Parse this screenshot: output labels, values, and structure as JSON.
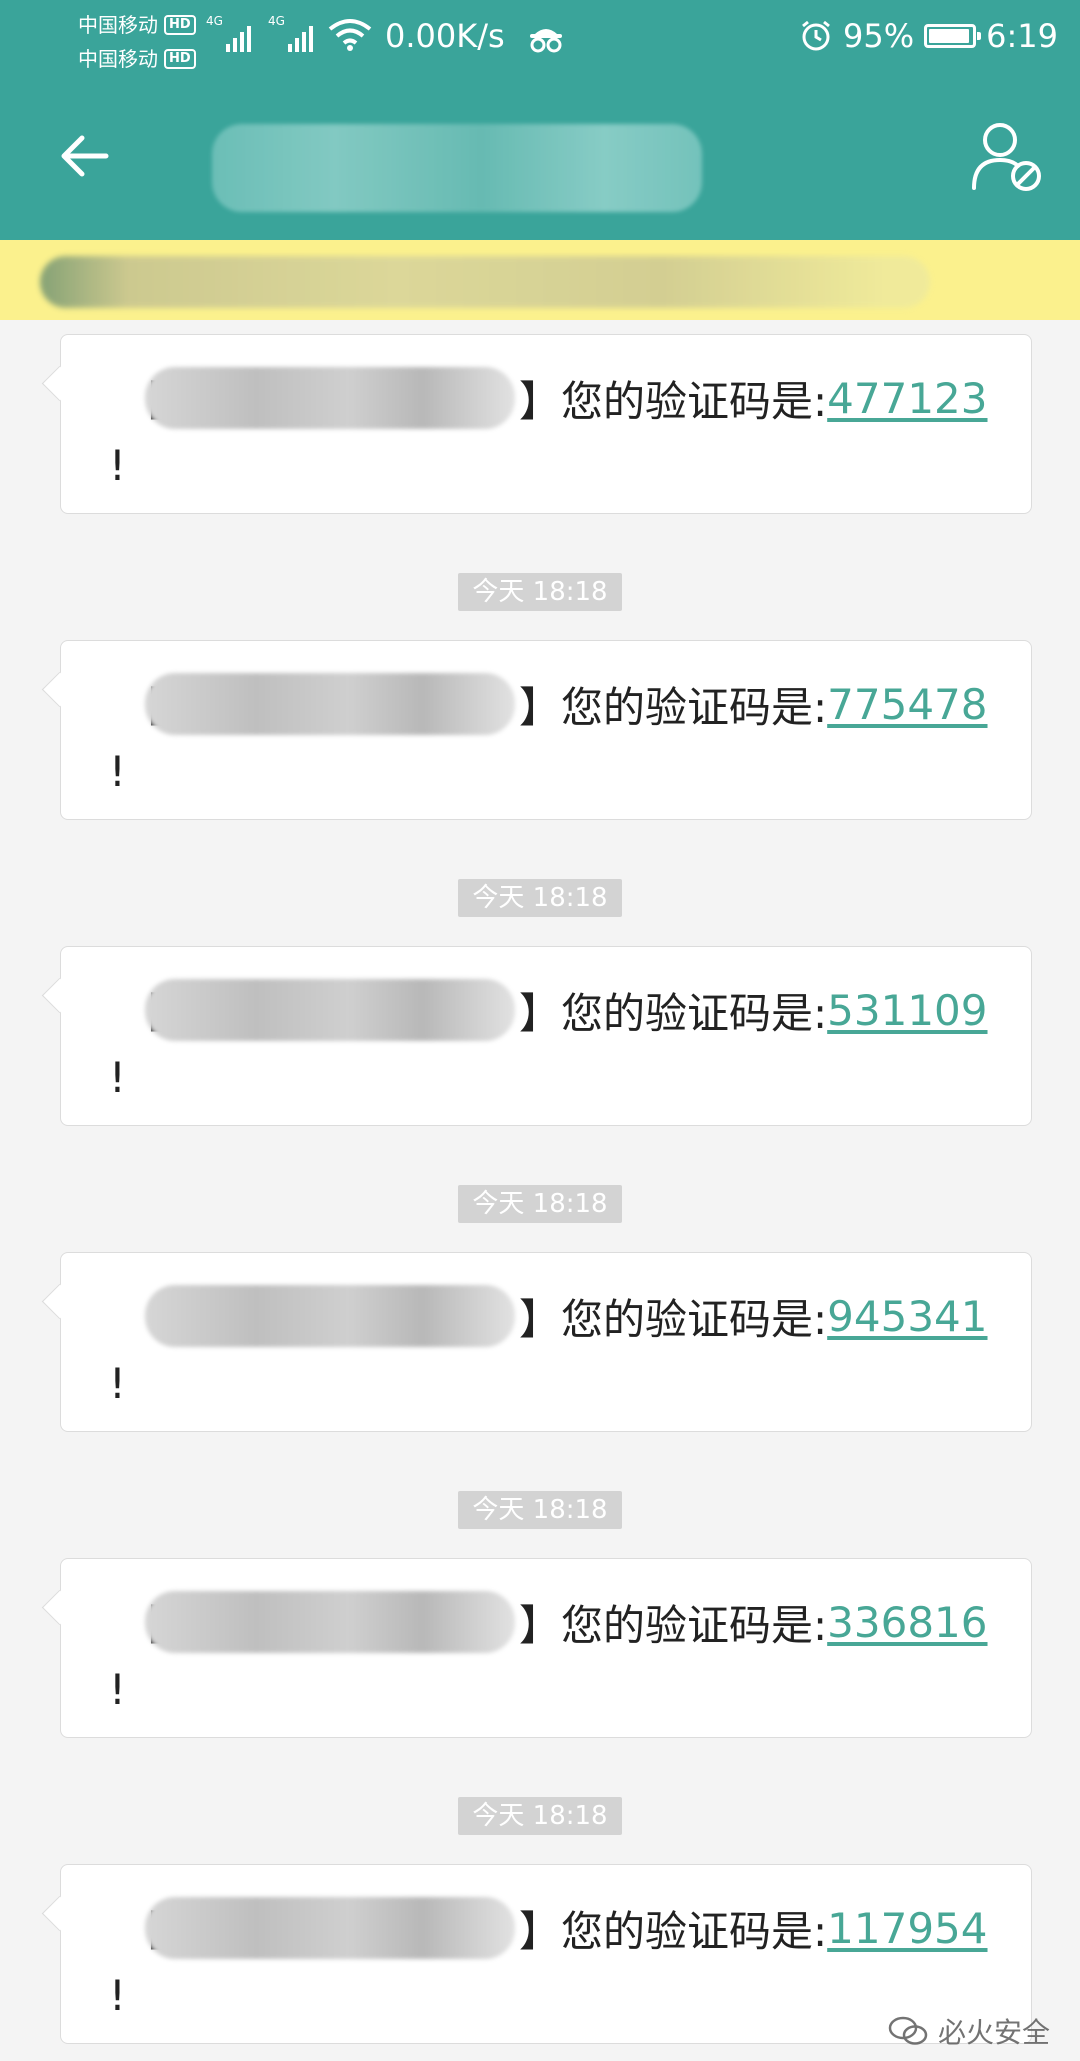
{
  "status_bar": {
    "carrier1": "中国移动",
    "carrier2": "中国移动",
    "hd": "HD",
    "network": "4G",
    "speed": "0.00K/s",
    "battery": "95%",
    "time": "6:19"
  },
  "header": {
    "back_icon": "arrow-left-icon",
    "contact_icon": "user-blocked-icon"
  },
  "colors": {
    "accent": "#3aa49a",
    "notice_bg": "#fbf18d",
    "code_link": "#48a796"
  },
  "messages": [
    {
      "open": "【",
      "close": "】",
      "text": "您的验证码是:",
      "code": "477123",
      "end": "!"
    },
    {
      "open": "【",
      "close": "】",
      "text": "您的验证码是:",
      "code": "775478",
      "end": "!"
    },
    {
      "open": "【",
      "close": "】",
      "text": "您的验证码是:",
      "code": "531109",
      "end": "!"
    },
    {
      "open": "",
      "close": "】",
      "text": "您的验证码是:",
      "code": "945341",
      "end": "!"
    },
    {
      "open": "【",
      "close": "】",
      "text": "您的验证码是:",
      "code": "336816",
      "end": "!"
    },
    {
      "open": "【",
      "close": "】",
      "text": "您的验证码是:",
      "code": "117954",
      "end": "!"
    }
  ],
  "timestamps": [
    "今天 18:18",
    "今天 18:18",
    "今天 18:18",
    "今天 18:18",
    "今天 18:18"
  ],
  "watermark": "必火安全"
}
